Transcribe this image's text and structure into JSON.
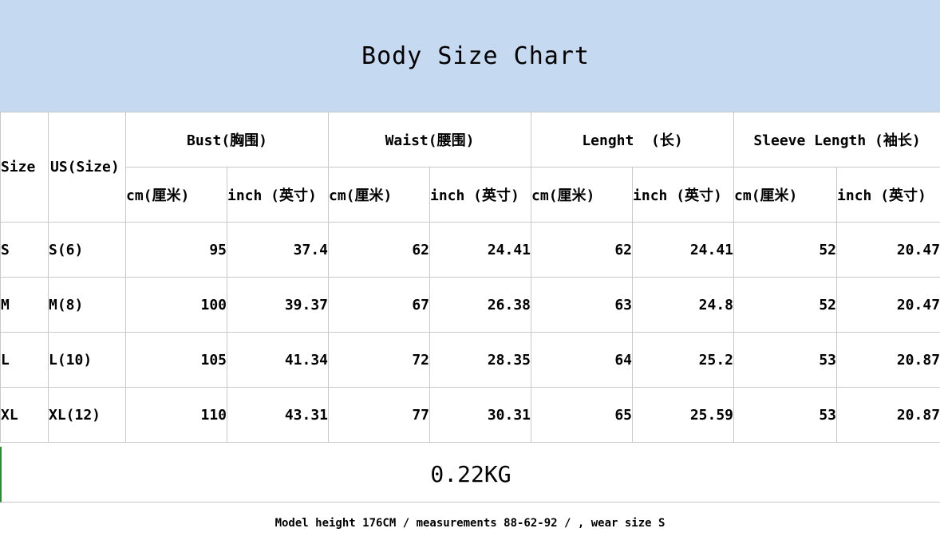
{
  "title": "Body Size Chart",
  "headers": {
    "size": "Size",
    "us_size": "US(Size)",
    "groups": [
      "Bust(胸围)",
      "Waist(腰围)",
      "Lenght  (长)",
      "Sleeve Length (袖长)"
    ],
    "units": [
      "cm(厘米)",
      "inch (英寸)",
      "cm(厘米)",
      "inch (英寸)",
      "cm(厘米)",
      "inch (英寸)",
      "cm(厘米)",
      "inch (英寸)"
    ]
  },
  "rows": [
    {
      "size": "S",
      "us": "S(6)",
      "values": [
        "95",
        "37.4",
        "62",
        "24.41",
        "62",
        "24.41",
        "52",
        "20.47"
      ]
    },
    {
      "size": "M",
      "us": "M(8)",
      "values": [
        "100",
        "39.37",
        "67",
        "26.38",
        "63",
        "24.8",
        "52",
        "20.47"
      ]
    },
    {
      "size": "L",
      "us": "L(10)",
      "values": [
        "105",
        "41.34",
        "72",
        "28.35",
        "64",
        "25.2",
        "53",
        "20.87"
      ]
    },
    {
      "size": "XL",
      "us": "XL(12)",
      "values": [
        "110",
        "43.31",
        "77",
        "30.31",
        "65",
        "25.59",
        "53",
        "20.87"
      ]
    }
  ],
  "weight": "0.22KG",
  "note": "Model height 176CM / measurements 88-62-92 / , wear size S"
}
